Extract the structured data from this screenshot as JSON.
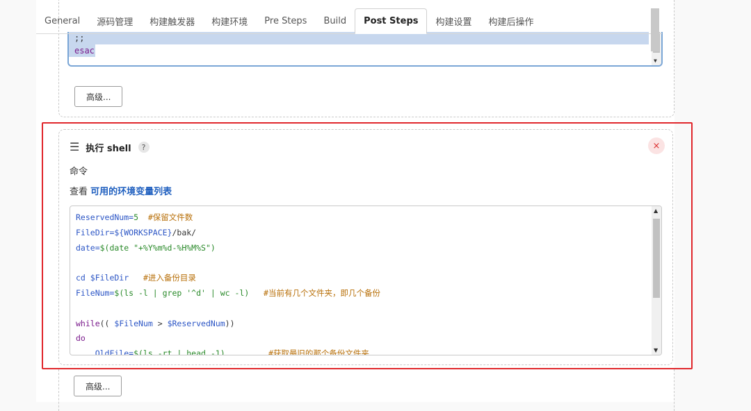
{
  "tabs": [
    "General",
    "源码管理",
    "构建触发器",
    "构建环境",
    "Pre Steps",
    "Build",
    "Post Steps",
    "构建设置",
    "构建后操作"
  ],
  "active_tab": "Post Steps",
  "prev_editor": {
    "lines": [
      "    ;;",
      "esac"
    ]
  },
  "advanced_button": "高级...",
  "step": {
    "title": "执行 shell",
    "help": "?",
    "close": "×",
    "command_label": "命令",
    "env_prefix": "查看 ",
    "env_link": "可用的环境变量列表"
  },
  "code": {
    "line1_var": "ReservedNum=",
    "line1_num": "5",
    "line1_com": "  #保留文件数",
    "line2_var": "FileDir=${WORKSPACE}",
    "line2_rest": "/bak/",
    "line3_var": "date=",
    "line3_str": "$(date \"+%Y%m%d-%H%M%S\")",
    "line4": "",
    "line5_var": "cd $FileDir",
    "line5_com": "   #进入备份目录",
    "line6_var": "FileNum=",
    "line6_str": "$(ls -l | grep '^d' | wc -l)",
    "line6_com": "   #当前有几个文件夹，即几个备份",
    "line7": "",
    "line8_kw": "while",
    "line8_rest": "(( ",
    "line8_var1": "$FileNum",
    "line8_mid": " > ",
    "line8_var2": "$ReservedNum",
    "line8_end": "))",
    "line9_kw": "do",
    "line10_var": "    OldFile=",
    "line10_str": "$(ls -rt | head -1)",
    "line10_com": "         #获取最旧的那个备份文件夹"
  }
}
